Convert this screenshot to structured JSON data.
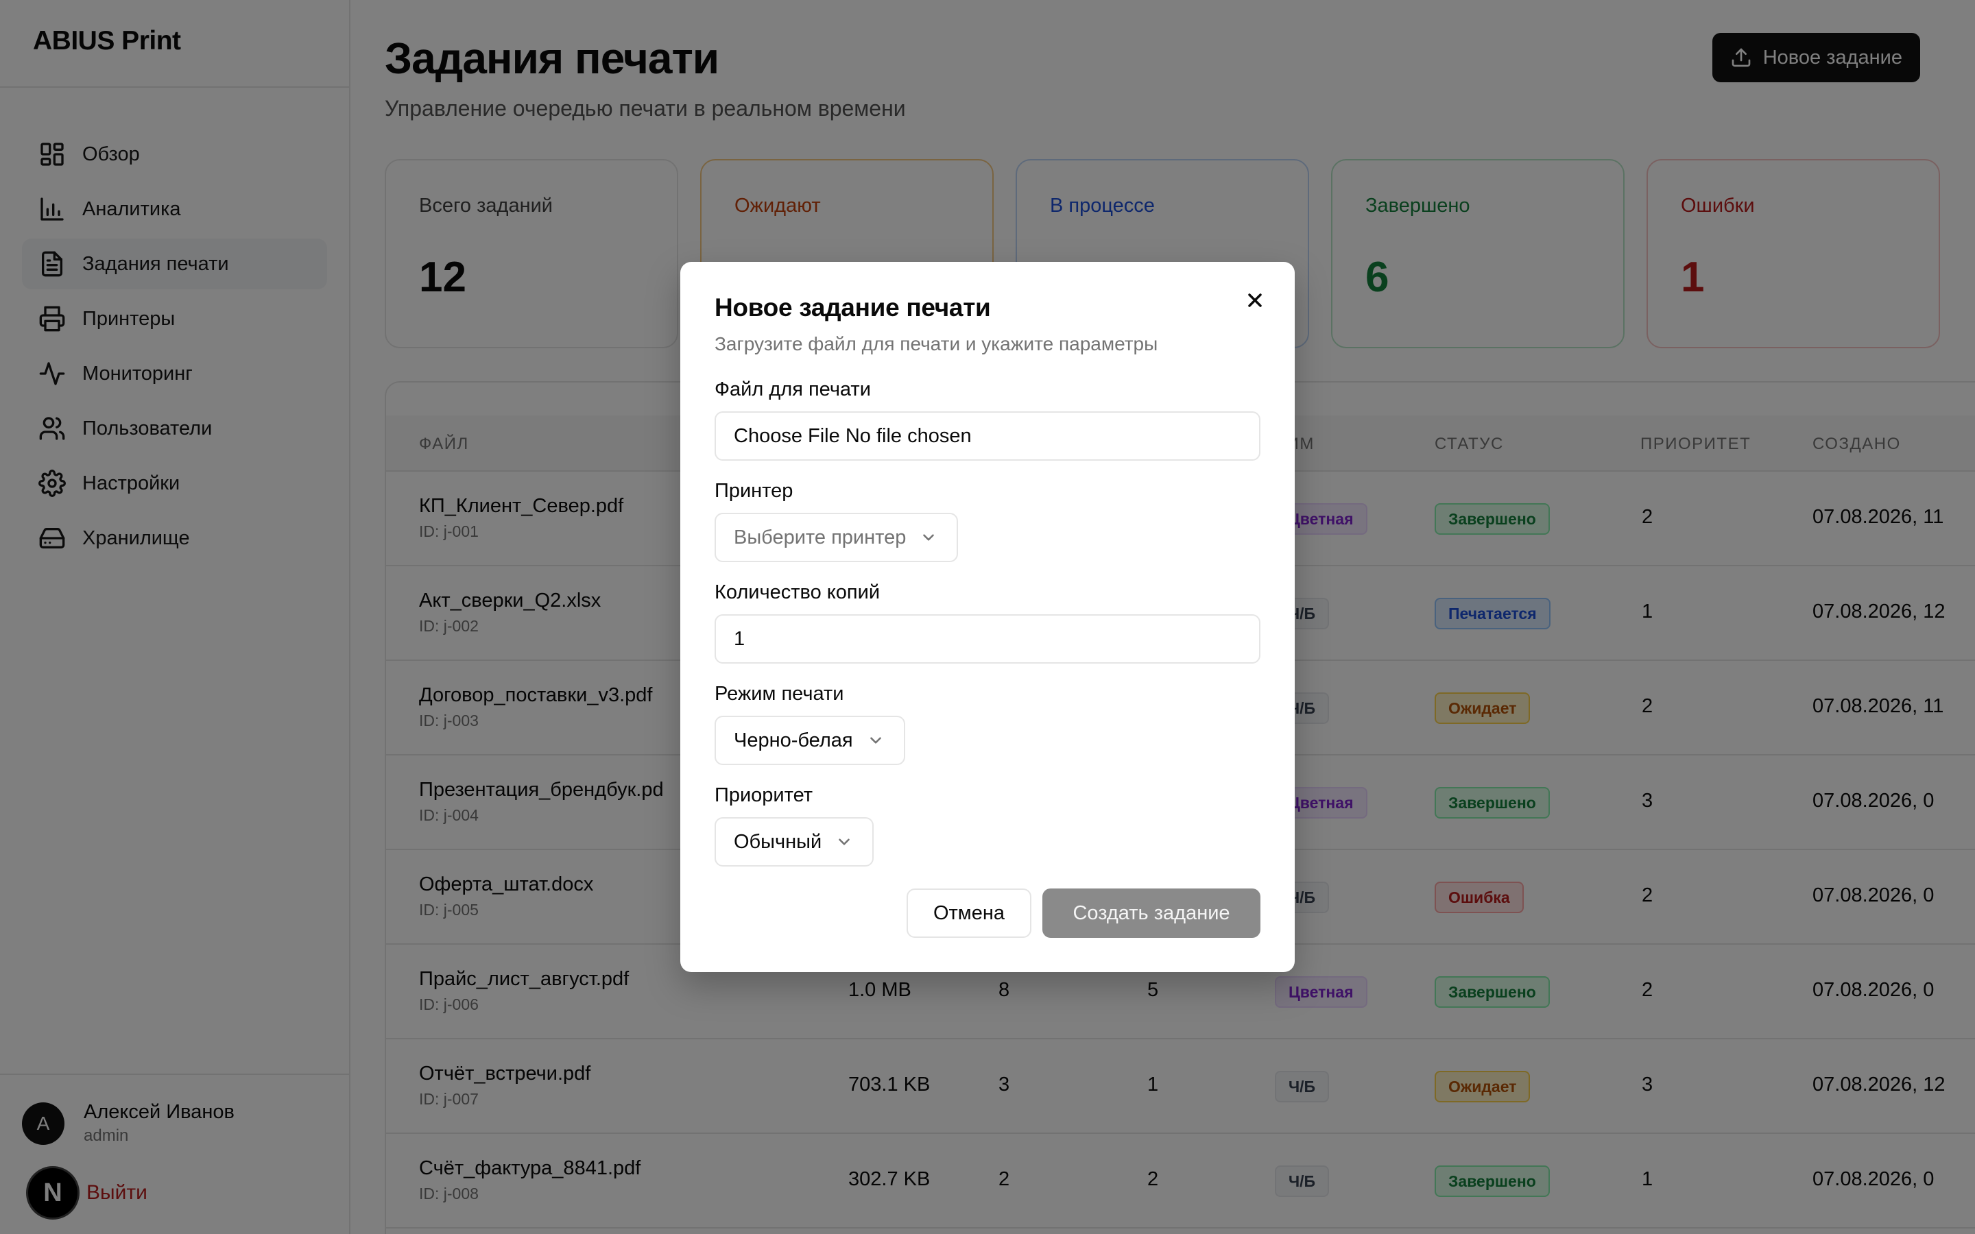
{
  "app": {
    "brand": "ABIUS Print"
  },
  "sidebar": {
    "items": [
      {
        "label": "Обзор",
        "icon": "dashboard-icon"
      },
      {
        "label": "Аналитика",
        "icon": "bar-chart-icon"
      },
      {
        "label": "Задания печати",
        "icon": "document-icon",
        "active": true
      },
      {
        "label": "Принтеры",
        "icon": "printer-icon"
      },
      {
        "label": "Мониторинг",
        "icon": "activity-icon"
      },
      {
        "label": "Пользователи",
        "icon": "users-icon"
      },
      {
        "label": "Настройки",
        "icon": "gear-icon"
      },
      {
        "label": "Хранилище",
        "icon": "storage-icon"
      }
    ],
    "user": {
      "initial": "A",
      "name": "Алексей Иванов",
      "role": "admin"
    },
    "next_badge": "N",
    "logout": "Выйти"
  },
  "header": {
    "title": "Задания печати",
    "subtitle": "Управление очередью печати в реальном времени",
    "new_job_label": "Новое задание"
  },
  "stats": [
    {
      "label": "Всего заданий",
      "value": "12"
    },
    {
      "label": "Ожидают",
      "value": ""
    },
    {
      "label": "В процессе",
      "value": ""
    },
    {
      "label": "Завершено",
      "value": "6"
    },
    {
      "label": "Ошибки",
      "value": "1"
    }
  ],
  "table": {
    "columns": [
      "Файл",
      "",
      "",
      "",
      "жим",
      "Статус",
      "Приоритет",
      "Создано"
    ],
    "rows": [
      {
        "file": "КП_Клиент_Север.pdf",
        "id": "ID: j-001",
        "size": "",
        "pages": "",
        "copies": "",
        "mode": "Цветная",
        "mode_type": "color",
        "status": "Завершено",
        "status_type": "done",
        "priority": "2",
        "created": "07.08.2026, 11"
      },
      {
        "file": "Акт_сверки_Q2.xlsx",
        "id": "ID: j-002",
        "size": "",
        "pages": "",
        "copies": "",
        "mode": "Ч/Б",
        "mode_type": "bw",
        "status": "Печатается",
        "status_type": "printing",
        "priority": "1",
        "created": "07.08.2026, 12"
      },
      {
        "file": "Договор_поставки_v3.pdf",
        "id": "ID: j-003",
        "size": "",
        "pages": "",
        "copies": "",
        "mode": "Ч/Б",
        "mode_type": "bw",
        "status": "Ожидает",
        "status_type": "pending",
        "priority": "2",
        "created": "07.08.2026, 11"
      },
      {
        "file": "Презентация_брендбук.pd",
        "id": "ID: j-004",
        "size": "",
        "pages": "",
        "copies": "",
        "mode": "Цветная",
        "mode_type": "color",
        "status": "Завершено",
        "status_type": "done",
        "priority": "3",
        "created": "07.08.2026, 0"
      },
      {
        "file": "Оферта_штат.docx",
        "id": "ID: j-005",
        "size": "",
        "pages": "",
        "copies": "",
        "mode": "Ч/Б",
        "mode_type": "bw",
        "status": "Ошибка",
        "status_type": "error",
        "priority": "2",
        "created": "07.08.2026, 0"
      },
      {
        "file": "Прайс_лист_август.pdf",
        "id": "ID: j-006",
        "size": "1.0 MB",
        "pages": "8",
        "copies": "5",
        "mode": "Цветная",
        "mode_type": "color",
        "status": "Завершено",
        "status_type": "done",
        "priority": "2",
        "created": "07.08.2026, 0"
      },
      {
        "file": "Отчёт_встречи.pdf",
        "id": "ID: j-007",
        "size": "703.1 KB",
        "pages": "3",
        "copies": "1",
        "mode": "Ч/Б",
        "mode_type": "bw",
        "status": "Ожидает",
        "status_type": "pending",
        "priority": "3",
        "created": "07.08.2026, 12"
      },
      {
        "file": "Счёт_фактура_8841.pdf",
        "id": "ID: j-008",
        "size": "302.7 KB",
        "pages": "2",
        "copies": "2",
        "mode": "Ч/Б",
        "mode_type": "bw",
        "status": "Завершено",
        "status_type": "done",
        "priority": "1",
        "created": "07.08.2026, 0"
      }
    ]
  },
  "dialog": {
    "title": "Новое задание печати",
    "description": "Загрузите файл для печати и укажите параметры",
    "file_label": "Файл для печати",
    "file_button": "Choose File",
    "file_status": "No file chosen",
    "printer_label": "Принтер",
    "printer_placeholder": "Выберите принтер",
    "copies_label": "Количество копий",
    "copies_value": "1",
    "mode_label": "Режим печати",
    "mode_value": "Черно-белая",
    "priority_label": "Приоритет",
    "priority_value": "Обычный",
    "cancel_label": "Отмена",
    "submit_label": "Создать задание"
  }
}
